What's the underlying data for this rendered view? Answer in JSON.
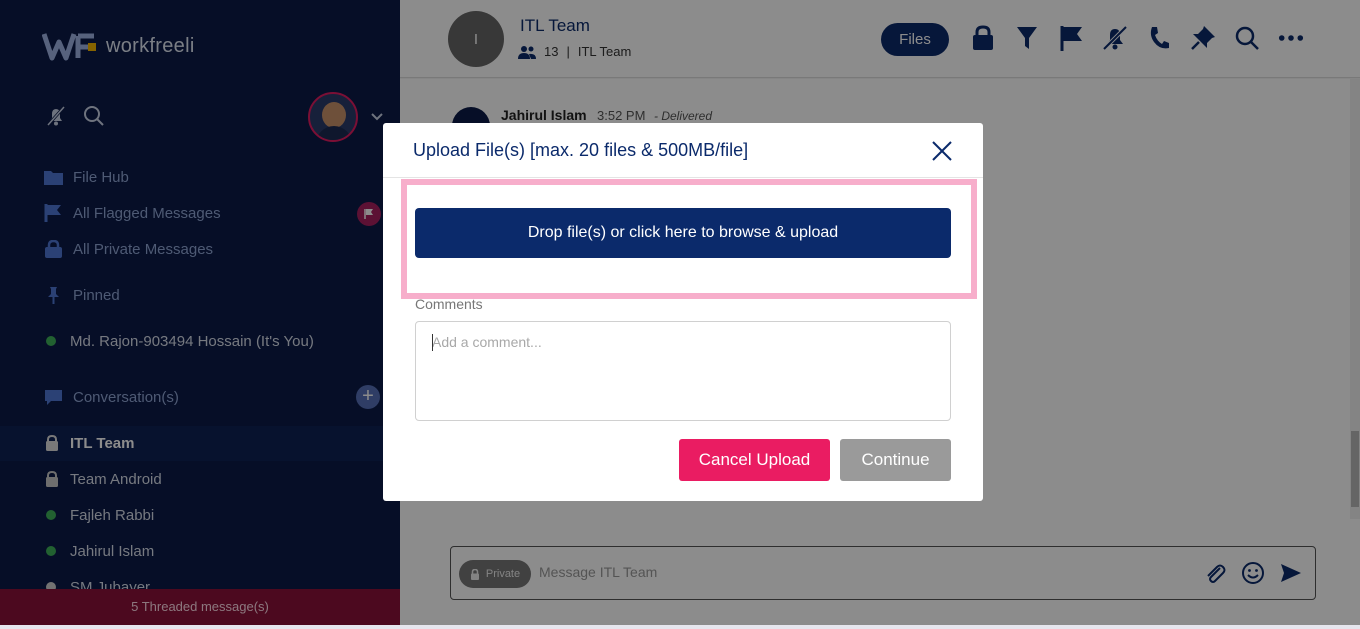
{
  "app": {
    "name": "workfreeli"
  },
  "sidebar": {
    "items": [
      {
        "label": "File Hub",
        "icon": "folder-icon"
      },
      {
        "label": "All Flagged Messages",
        "icon": "flag-icon"
      },
      {
        "label": "All Private Messages",
        "icon": "lock-icon"
      },
      {
        "label": "Pinned",
        "icon": "pin-icon"
      },
      {
        "label": "Md. Rajon-903494 Hossain (It's You)",
        "icon": "online-dot"
      }
    ],
    "conversations_label": "Conversation(s)",
    "conversations": [
      {
        "label": "ITL Team",
        "icon": "lock-icon",
        "active": true
      },
      {
        "label": "Team Android",
        "icon": "lock-icon"
      },
      {
        "label": "Fajleh Rabbi",
        "icon": "online-dot"
      },
      {
        "label": "Jahirul Islam",
        "icon": "online-dot"
      },
      {
        "label": "SM Jubayer",
        "icon": "offline-dot"
      }
    ],
    "threaded": "5 Threaded message(s)"
  },
  "header": {
    "avatar_initial": "I",
    "title": "ITL Team",
    "member_count": "13",
    "separator": "|",
    "subtitle": "ITL Team",
    "files_label": "Files",
    "icons": [
      "lock-icon",
      "filter-icon",
      "flag-icon",
      "mute-icon",
      "phone-icon",
      "pin-icon",
      "search-icon",
      "more-icon"
    ]
  },
  "message": {
    "author": "Jahirul Islam",
    "time": "3:52 PM",
    "status": "- Delivered"
  },
  "composer": {
    "private_label": "Private",
    "placeholder": "Message ITL Team"
  },
  "modal": {
    "title": "Upload File(s) [max. 20 files & 500MB/file]",
    "drop_label": "Drop file(s) or click here to browse & upload",
    "comments_label": "Comments",
    "comment_placeholder": "Add a comment...",
    "cancel_label": "Cancel Upload",
    "continue_label": "Continue"
  },
  "colors": {
    "sidebar_bg": "#0b1a47",
    "brand_navy": "#0b2a6b",
    "accent_pink": "#ea1c62",
    "highlight_frame": "#f7aecb",
    "threaded_bar": "#8a1239"
  }
}
